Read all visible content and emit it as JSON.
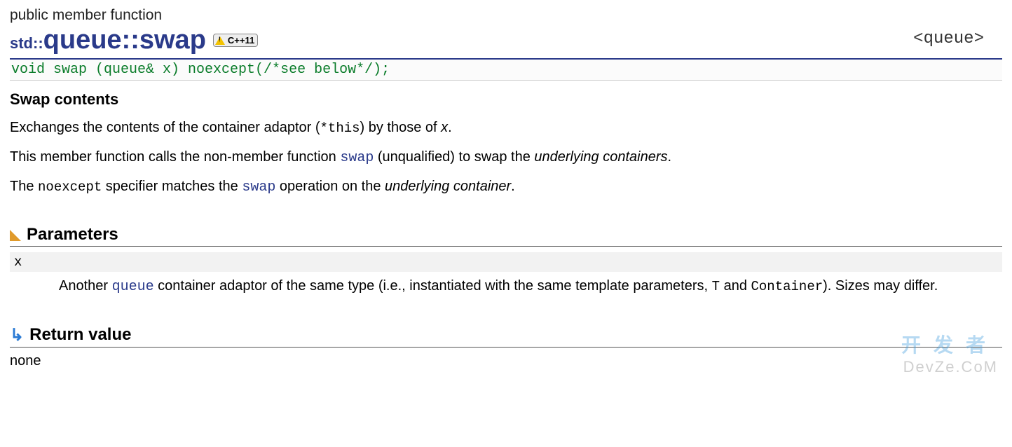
{
  "header": {
    "page_type": "public member function",
    "namespace": "std::",
    "title": "queue::swap",
    "badge_label": "C++11",
    "breadcrumb": "<queue>"
  },
  "signature": "void swap (queue& x) noexcept(/*see below*/);",
  "subtitle": "Swap contents",
  "desc": {
    "p1a": "Exchanges the contents of the container adaptor (",
    "p1_code": "*this",
    "p1b": ") by those of ",
    "p1_em": "x",
    "p1c": ".",
    "p2a": "This member function calls the non-member function ",
    "p2_link": "swap",
    "p2b": " (unqualified) to swap the ",
    "p2_em": "underlying containers",
    "p2c": ".",
    "p3a": "The ",
    "p3_code": "noexcept",
    "p3b": " specifier matches the ",
    "p3_link": "swap",
    "p3c": " operation on the ",
    "p3_em": "underlying container",
    "p3d": "."
  },
  "sections": {
    "parameters": "Parameters",
    "return_value": "Return value"
  },
  "params": {
    "name": "x",
    "dd_a": "Another ",
    "dd_link": "queue",
    "dd_b": " container adaptor of the same type (i.e., instantiated with the same template parameters, ",
    "dd_code1": "T",
    "dd_c": " and ",
    "dd_code2": "Container",
    "dd_d": "). Sizes may differ."
  },
  "return_text": "none",
  "watermark": {
    "line1": "开发者",
    "line2": "DevZe.CoM"
  }
}
